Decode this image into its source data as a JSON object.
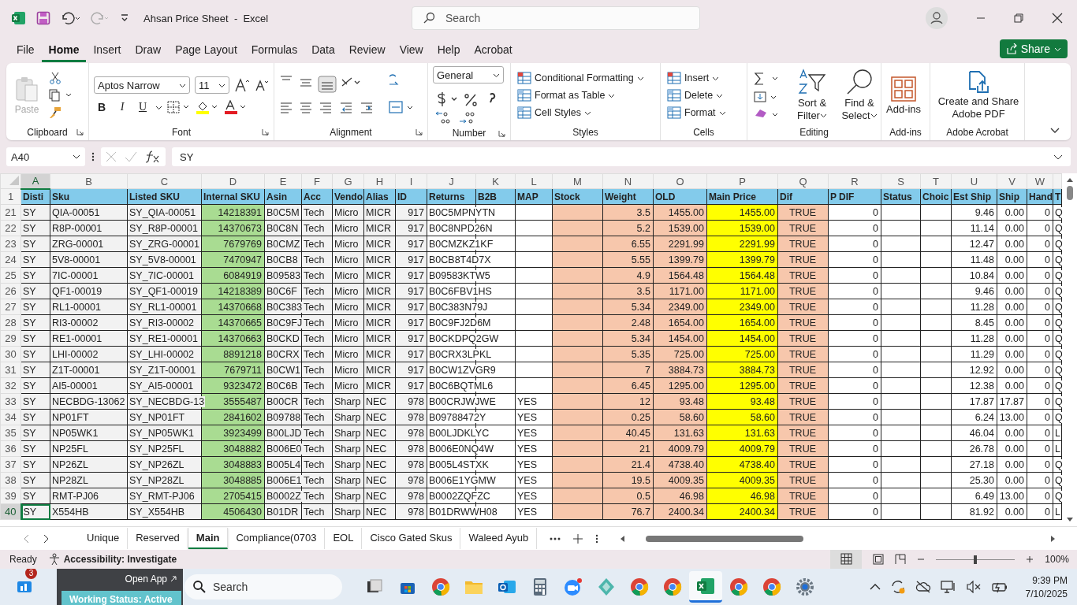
{
  "window": {
    "title": "Ahsan Price Sheet  -  Excel",
    "search": {
      "placeholder": "Search"
    }
  },
  "ribbon_tabs": [
    {
      "label": "File",
      "selected": false
    },
    {
      "label": "Home",
      "selected": true
    },
    {
      "label": "Insert",
      "selected": false
    },
    {
      "label": "Draw",
      "selected": false
    },
    {
      "label": "Page Layout",
      "selected": false
    },
    {
      "label": "Formulas",
      "selected": false
    },
    {
      "label": "Data",
      "selected": false
    },
    {
      "label": "Review",
      "selected": false
    },
    {
      "label": "View",
      "selected": false
    },
    {
      "label": "Help",
      "selected": false
    },
    {
      "label": "Acrobat",
      "selected": false
    }
  ],
  "share_button": "Share",
  "ribbon_groups": [
    {
      "kind": "clipboard",
      "label": "Clipboard",
      "buttons": [
        {
          "label": "Paste",
          "disabled": true
        }
      ]
    },
    {
      "kind": "font",
      "label": "Font",
      "font": "Aptos Narrow",
      "size": "11",
      "buttons": [
        {
          "label": "B"
        },
        {
          "label": "I"
        },
        {
          "label": "U"
        }
      ]
    },
    {
      "kind": "alignment",
      "label": "Alignment"
    },
    {
      "kind": "number",
      "label": "Number",
      "format": "General"
    },
    {
      "kind": "styles",
      "label": "Styles",
      "buttons": [
        {
          "label": "Conditional Formatting"
        },
        {
          "label": "Format as Table"
        },
        {
          "label": "Cell Styles"
        }
      ]
    },
    {
      "kind": "cells",
      "label": "Cells",
      "buttons": [
        {
          "label": "Insert"
        },
        {
          "label": "Delete"
        },
        {
          "label": "Format"
        }
      ]
    },
    {
      "kind": "editing",
      "label": "Editing",
      "buttons": [
        {
          "label": "Sort & Filter"
        },
        {
          "label": "Find & Select"
        }
      ]
    },
    {
      "kind": "addins",
      "label": "Add-ins",
      "buttons": [
        {
          "label": "Add-ins"
        }
      ]
    },
    {
      "kind": "acrobat",
      "label": "Adobe Acrobat",
      "buttons": [
        {
          "label": "Create and Share Adobe PDF"
        }
      ]
    }
  ],
  "formula_bar": {
    "name_box": "A40",
    "formula": "SY"
  },
  "sheet": {
    "columns": [
      {
        "letter": "A",
        "header": "Disti",
        "kind": "text",
        "color": "#f2f2f2",
        "selected": true
      },
      {
        "letter": "B",
        "header": "Sku",
        "kind": "text",
        "color": "#f2f2f2",
        "selected": false
      },
      {
        "letter": "C",
        "header": "Listed SKU",
        "kind": "text",
        "color": "#f2f2f2",
        "selected": false
      },
      {
        "letter": "D",
        "header": "Internal SKU",
        "kind": "number",
        "color": "#a9dc92",
        "selected": false
      },
      {
        "letter": "E",
        "header": "Asin",
        "kind": "text",
        "color": "#f2f2f2",
        "selected": false
      },
      {
        "letter": "F",
        "header": "Acc",
        "kind": "text",
        "color": "#f2f2f2",
        "selected": false
      },
      {
        "letter": "G",
        "header": "Vendo",
        "kind": "text",
        "color": "#f2f2f2",
        "selected": false
      },
      {
        "letter": "H",
        "header": "Alias",
        "kind": "text",
        "color": "#f2f2f2",
        "selected": false
      },
      {
        "letter": "I",
        "header": "ID",
        "kind": "number",
        "color": "#f2f2f2",
        "selected": false
      },
      {
        "letter": "J",
        "header": "Returns",
        "kind": "text",
        "color": "#ffffff",
        "selected": false
      },
      {
        "letter": "K",
        "header": "B2B",
        "kind": "text",
        "color": "#ffffff",
        "selected": false
      },
      {
        "letter": "L",
        "header": "MAP",
        "kind": "text",
        "color": "#ffffff",
        "selected": false
      },
      {
        "letter": "M",
        "header": "Stock",
        "kind": "number",
        "color": "#f7c7ac",
        "selected": false
      },
      {
        "letter": "N",
        "header": "Weight",
        "kind": "number",
        "color": "#f7c7ac",
        "selected": false
      },
      {
        "letter": "O",
        "header": "OLD",
        "kind": "number",
        "color": "#f7c7ac",
        "selected": false
      },
      {
        "letter": "P",
        "header": "Main Price",
        "kind": "number",
        "color": "#ffff00",
        "selected": false
      },
      {
        "letter": "Q",
        "header": "Dif",
        "kind": "center",
        "color": "#f7c7ac",
        "selected": false
      },
      {
        "letter": "R",
        "header": "P DIF",
        "kind": "number",
        "color": "#ffffff",
        "selected": false
      },
      {
        "letter": "S",
        "header": "Status",
        "kind": "text",
        "color": "#ffffff",
        "selected": false
      },
      {
        "letter": "T",
        "header": "Choic",
        "kind": "text",
        "color": "#ffffff",
        "selected": false
      },
      {
        "letter": "U",
        "header": "Est Ship",
        "kind": "number",
        "color": "#ffffff",
        "selected": false
      },
      {
        "letter": "V",
        "header": "Ship",
        "kind": "number",
        "color": "#ffffff",
        "selected": false
      },
      {
        "letter": "W",
        "header": "Hand",
        "kind": "number",
        "color": "#ffffff",
        "selected": false
      },
      {
        "header": "T",
        "kind": "text",
        "color": "#ffffff",
        "selected": false
      }
    ],
    "header_row": "1",
    "rows": [
      {
        "num": "21",
        "selected": false,
        "cells": [
          "SY",
          "QIA-00051",
          "SY_QIA-00051",
          "14218391",
          "B0C5M",
          "Tech",
          "Micro",
          "MICR",
          "917",
          "B0C5MPNYTN",
          null,
          null,
          null,
          "3.5",
          "1455.00",
          "1455.00",
          "TRUE",
          "0",
          null,
          null,
          "9.46",
          "0.00",
          "0",
          "Q"
        ]
      },
      {
        "num": "22",
        "selected": false,
        "cells": [
          "SY",
          "R8P-00001",
          "SY_R8P-00001",
          "14370673",
          "B0C8N",
          "Tech",
          "Micro",
          "MICR",
          "917",
          "B0C8NPD26N",
          null,
          null,
          null,
          "5.2",
          "1539.00",
          "1539.00",
          "TRUE",
          "0",
          null,
          null,
          "11.14",
          "0.00",
          "0",
          "Q"
        ]
      },
      {
        "num": "23",
        "selected": false,
        "cells": [
          "SY",
          "ZRG-00001",
          "SY_ZRG-00001",
          "7679769",
          "B0CMZ",
          "Tech",
          "Micro",
          "MICR",
          "917",
          "B0CMZKZ1KF",
          null,
          null,
          null,
          "6.55",
          "2291.99",
          "2291.99",
          "TRUE",
          "0",
          null,
          null,
          "12.47",
          "0.00",
          "0",
          "Q"
        ]
      },
      {
        "num": "24",
        "selected": false,
        "cells": [
          "SY",
          "5V8-00001",
          "SY_5V8-00001",
          "7470947",
          "B0CB8",
          "Tech",
          "Micro",
          "MICR",
          "917",
          "B0CB8T4D7X",
          null,
          null,
          null,
          "5.55",
          "1399.79",
          "1399.79",
          "TRUE",
          "0",
          null,
          null,
          "11.48",
          "0.00",
          "0",
          "Q"
        ]
      },
      {
        "num": "25",
        "selected": false,
        "cells": [
          "SY",
          "7IC-00001",
          "SY_7IC-00001",
          "6084919",
          "B09583",
          "Tech",
          "Micro",
          "MICR",
          "917",
          "B09583KTW5",
          null,
          null,
          null,
          "4.9",
          "1564.48",
          "1564.48",
          "TRUE",
          "0",
          null,
          null,
          "10.84",
          "0.00",
          "0",
          "Q"
        ]
      },
      {
        "num": "26",
        "selected": false,
        "cells": [
          "SY",
          "QF1-00019",
          "SY_QF1-00019",
          "14218389",
          "B0C6F",
          "Tech",
          "Micro",
          "MICR",
          "917",
          "B0C6FBV1HS",
          null,
          null,
          null,
          "3.5",
          "1171.00",
          "1171.00",
          "TRUE",
          "0",
          null,
          null,
          "9.46",
          "0.00",
          "0",
          "Q"
        ]
      },
      {
        "num": "27",
        "selected": false,
        "cells": [
          "SY",
          "RL1-00001",
          "SY_RL1-00001",
          "14370668",
          "B0C383",
          "Tech",
          "Micro",
          "MICR",
          "917",
          "B0C383N79J",
          null,
          null,
          null,
          "5.34",
          "2349.00",
          "2349.00",
          "TRUE",
          "0",
          null,
          null,
          "11.28",
          "0.00",
          "0",
          "Q"
        ]
      },
      {
        "num": "28",
        "selected": false,
        "cells": [
          "SY",
          "RI3-00002",
          "SY_RI3-00002",
          "14370665",
          "B0C9FJ",
          "Tech",
          "Micro",
          "MICR",
          "917",
          "B0C9FJ2D6M",
          null,
          null,
          null,
          "2.48",
          "1654.00",
          "1654.00",
          "TRUE",
          "0",
          null,
          null,
          "8.45",
          "0.00",
          "0",
          "Q"
        ]
      },
      {
        "num": "29",
        "selected": false,
        "cells": [
          "SY",
          "RE1-00001",
          "SY_RE1-00001",
          "14370663",
          "B0CKD",
          "Tech",
          "Micro",
          "MICR",
          "917",
          "B0CKDPQ2GW",
          null,
          null,
          null,
          "5.34",
          "1454.00",
          "1454.00",
          "TRUE",
          "0",
          null,
          null,
          "11.28",
          "0.00",
          "0",
          "Q"
        ]
      },
      {
        "num": "30",
        "selected": false,
        "cells": [
          "SY",
          "LHI-00002",
          "SY_LHI-00002",
          "8891218",
          "B0CRX",
          "Tech",
          "Micro",
          "MICR",
          "917",
          "B0CRX3LPKL",
          null,
          null,
          null,
          "5.35",
          "725.00",
          "725.00",
          "TRUE",
          "0",
          null,
          null,
          "11.29",
          "0.00",
          "0",
          "Q"
        ]
      },
      {
        "num": "31",
        "selected": false,
        "cells": [
          "SY",
          "Z1T-00001",
          "SY_Z1T-00001",
          "7679711",
          "B0CW1",
          "Tech",
          "Micro",
          "MICR",
          "917",
          "B0CW1ZVGR9",
          null,
          null,
          null,
          "7",
          "3884.73",
          "3884.73",
          "TRUE",
          "0",
          null,
          null,
          "12.92",
          "0.00",
          "0",
          "Q"
        ]
      },
      {
        "num": "32",
        "selected": false,
        "cells": [
          "SY",
          "AI5-00001",
          "SY_AI5-00001",
          "9323472",
          "B0C6B",
          "Tech",
          "Micro",
          "MICR",
          "917",
          "B0C6BQTML6",
          null,
          null,
          null,
          "6.45",
          "1295.00",
          "1295.00",
          "TRUE",
          "0",
          null,
          null,
          "12.38",
          "0.00",
          "0",
          "Q"
        ]
      },
      {
        "num": "33",
        "selected": false,
        "cells": [
          "SY",
          "NECBDG-13062",
          "SY_NECBDG-13",
          "3555487",
          "B00CR",
          "Tech",
          "Sharp",
          "NEC",
          "978",
          "B00CRJWJWE",
          null,
          "YES",
          null,
          "12",
          "93.48",
          "93.48",
          "TRUE",
          "0",
          null,
          null,
          "17.87",
          "17.87",
          "0",
          "Q"
        ]
      },
      {
        "num": "34",
        "selected": false,
        "cells": [
          "SY",
          "NP01FT",
          "SY_NP01FT",
          "2841602",
          "B09788",
          "Tech",
          "Sharp",
          "NEC",
          "978",
          "B09788472Y",
          null,
          "YES",
          null,
          "0.25",
          "58.60",
          "58.60",
          "TRUE",
          "0",
          null,
          null,
          "6.24",
          "13.00",
          "0",
          "Q"
        ]
      },
      {
        "num": "35",
        "selected": false,
        "cells": [
          "SY",
          "NP05WK1",
          "SY_NP05WK1",
          "3923499",
          "B00LJD",
          "Tech",
          "Sharp",
          "NEC",
          "978",
          "B00LJDKLYC",
          null,
          "YES",
          null,
          "40.45",
          "131.63",
          "131.63",
          "TRUE",
          "0",
          null,
          null,
          "46.04",
          "0.00",
          "0",
          "L"
        ]
      },
      {
        "num": "36",
        "selected": false,
        "cells": [
          "SY",
          "NP25FL",
          "SY_NP25FL",
          "3048882",
          "B006E0",
          "Tech",
          "Sharp",
          "NEC",
          "978",
          "B006E0NQ4W",
          null,
          "YES",
          null,
          "21",
          "4009.79",
          "4009.79",
          "TRUE",
          "0",
          null,
          null,
          "26.78",
          "0.00",
          "0",
          "L"
        ]
      },
      {
        "num": "37",
        "selected": false,
        "cells": [
          "SY",
          "NP26ZL",
          "SY_NP26ZL",
          "3048883",
          "B005L4",
          "Tech",
          "Sharp",
          "NEC",
          "978",
          "B005L4STXK",
          null,
          "YES",
          null,
          "21.4",
          "4738.40",
          "4738.40",
          "TRUE",
          "0",
          null,
          null,
          "27.18",
          "0.00",
          "0",
          "Q"
        ]
      },
      {
        "num": "38",
        "selected": false,
        "cells": [
          "SY",
          "NP28ZL",
          "SY_NP28ZL",
          "3048885",
          "B006E1",
          "Tech",
          "Sharp",
          "NEC",
          "978",
          "B006E1YGMW",
          null,
          "YES",
          null,
          "19.5",
          "4009.35",
          "4009.35",
          "TRUE",
          "0",
          null,
          null,
          "25.30",
          "0.00",
          "0",
          "Q"
        ]
      },
      {
        "num": "39",
        "selected": false,
        "cells": [
          "SY",
          "RMT-PJ06",
          "SY_RMT-PJ06",
          "2705415",
          "B0002Z",
          "Tech",
          "Sharp",
          "NEC",
          "978",
          "B0002ZQFZC",
          null,
          "YES",
          null,
          "0.5",
          "46.98",
          "46.98",
          "TRUE",
          "0",
          null,
          null,
          "6.49",
          "13.00",
          "0",
          "Q"
        ]
      },
      {
        "num": "40",
        "selected": true,
        "cells": [
          "SY",
          "X554HB",
          "SY_X554HB",
          "4506430",
          "B01DR",
          "Tech",
          "Sharp",
          "NEC",
          "978",
          "B01DRWWH08",
          null,
          "YES",
          null,
          "76.7",
          "2400.34",
          "2400.34",
          "TRUE",
          "0",
          null,
          null,
          "81.92",
          "0.00",
          "0",
          "L"
        ]
      }
    ]
  },
  "sheet_tabs": [
    {
      "label": "Unique",
      "selected": false
    },
    {
      "label": "Reserved",
      "selected": false
    },
    {
      "label": "Main",
      "selected": true
    },
    {
      "label": "Compliance(0703",
      "selected": false
    },
    {
      "label": "EOL",
      "selected": false
    },
    {
      "label": "Cisco Gated Skus",
      "selected": false
    },
    {
      "label": "Waleed Ayub",
      "selected": false
    }
  ],
  "status_bar": {
    "mode": "Ready",
    "accessibility": "Accessibility: Investigate",
    "zoom": "100%",
    "zoom_slider": {
      "level": 0.5
    }
  },
  "taskbar": {
    "widget_badge": "3",
    "popup": {
      "button": "Open App",
      "status": "Working Status: Active"
    },
    "search": {
      "placeholder": "Search"
    },
    "apps": [
      {
        "kind": "taskview",
        "active": false
      },
      {
        "kind": "store",
        "active": false
      },
      {
        "kind": "chrome",
        "active": false
      },
      {
        "kind": "folder",
        "active": false
      },
      {
        "kind": "mail",
        "active": false
      },
      {
        "kind": "calculator",
        "active": false
      },
      {
        "kind": "meeting",
        "active": false
      },
      {
        "kind": "diamond",
        "active": false
      },
      {
        "kind": "chrome",
        "active": false
      },
      {
        "kind": "chrome",
        "active": false
      },
      {
        "kind": "excel",
        "active": true
      },
      {
        "kind": "chrome",
        "active": false
      },
      {
        "kind": "chrome",
        "active": false
      },
      {
        "kind": "gear",
        "active": false
      }
    ],
    "time": "9:39 PM",
    "date": "7/10/2025"
  }
}
